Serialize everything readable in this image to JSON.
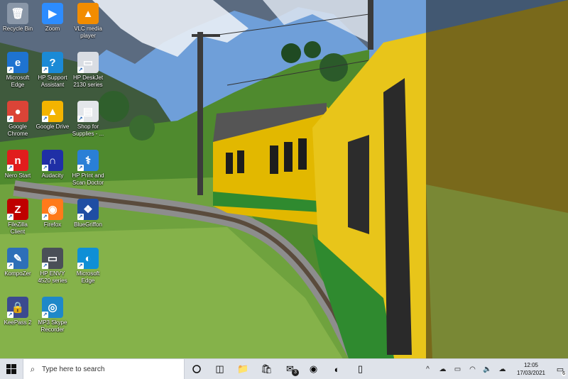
{
  "desktop_icons": [
    {
      "key": "recycle-bin",
      "label": "Recycle Bin",
      "icon": "recycle-bin-icon",
      "color": "#8a97a8",
      "glyph": "🗑"
    },
    {
      "key": "zoom",
      "label": "Zoom",
      "icon": "zoom-icon",
      "color": "#2d8cff",
      "glyph": "▶"
    },
    {
      "key": "vlc",
      "label": "VLC media player",
      "icon": "vlc-icon",
      "color": "#f28c00",
      "glyph": "▲"
    },
    {
      "key": "edge-legacy",
      "label": "Microsoft Edge",
      "icon": "edge-legacy-icon",
      "color": "#1e73d0",
      "glyph": "e"
    },
    {
      "key": "hp-support",
      "label": "HP Support Assistant",
      "icon": "hp-support-icon",
      "color": "#1b8ad6",
      "glyph": "?"
    },
    {
      "key": "hp-deskjet",
      "label": "HP DeskJet 2130 series",
      "icon": "printer-icon",
      "color": "#d9dde3",
      "glyph": "▭"
    },
    {
      "key": "chrome",
      "label": "Google Chrome",
      "icon": "chrome-icon",
      "color": "#db4437",
      "glyph": "●"
    },
    {
      "key": "google-drive",
      "label": "Google Drive",
      "icon": "google-drive-icon",
      "color": "#f4b400",
      "glyph": "▲"
    },
    {
      "key": "shop-supplies",
      "label": "Shop for Supplies - ...",
      "icon": "shop-supplies-icon",
      "color": "#e3e6ea",
      "glyph": "▤"
    },
    {
      "key": "nero",
      "label": "Nero Start",
      "icon": "nero-icon",
      "color": "#e11d1d",
      "glyph": "n"
    },
    {
      "key": "audacity",
      "label": "Audacity",
      "icon": "audacity-icon",
      "color": "#1f2fa6",
      "glyph": "∩"
    },
    {
      "key": "hp-print-scan",
      "label": "HP Print and Scan Doctor",
      "icon": "hp-print-scan-icon",
      "color": "#2a7fd6",
      "glyph": "⚕"
    },
    {
      "key": "filezilla",
      "label": "FileZilla Client",
      "icon": "filezilla-icon",
      "color": "#bf0000",
      "glyph": "Z"
    },
    {
      "key": "firefox",
      "label": "Firefox",
      "icon": "firefox-icon",
      "color": "#ff7a1a",
      "glyph": "◉"
    },
    {
      "key": "bluegriffon",
      "label": "BlueGriffon",
      "icon": "bluegriffon-icon",
      "color": "#1f4ea3",
      "glyph": "❖"
    },
    {
      "key": "kompozer",
      "label": "KompoZer",
      "icon": "kompozer-icon",
      "color": "#2d6fb8",
      "glyph": "✎"
    },
    {
      "key": "hp-envy",
      "label": "HP ENVY 4520 series",
      "icon": "printer-icon",
      "color": "#4a4f57",
      "glyph": "▭"
    },
    {
      "key": "edge",
      "label": "Microsoft Edge",
      "icon": "edge-icon",
      "color": "#0f8fd6",
      "glyph": "◐"
    },
    {
      "key": "keepass",
      "label": "KeePass 2",
      "icon": "keepass-icon",
      "color": "#3b4a8f",
      "glyph": "🔒"
    },
    {
      "key": "mp3-skype",
      "label": "MP3 Skype Recorder",
      "icon": "mp3-skype-recorder-icon",
      "color": "#1e88c9",
      "glyph": "◎"
    }
  ],
  "taskbar": {
    "search_placeholder": "Type here to search",
    "apps": [
      {
        "key": "task-view",
        "icon": "task-view-icon",
        "glyph": "◫",
        "running": false
      },
      {
        "key": "file-explorer",
        "icon": "file-explorer-icon",
        "glyph": "📁",
        "running": false
      },
      {
        "key": "store",
        "icon": "store-icon",
        "glyph": "🛍",
        "running": false
      },
      {
        "key": "mail",
        "icon": "mail-icon",
        "glyph": "✉",
        "running": false,
        "badge": "3"
      },
      {
        "key": "chrome",
        "icon": "chrome-icon",
        "glyph": "◉",
        "running": false
      },
      {
        "key": "edge",
        "icon": "edge-icon",
        "glyph": "◐",
        "running": false
      },
      {
        "key": "phone",
        "icon": "phone-icon",
        "glyph": "▯",
        "running": false
      }
    ],
    "tray": [
      {
        "key": "show-hidden",
        "icon": "chevron-up-icon",
        "glyph": "^"
      },
      {
        "key": "onedrive",
        "icon": "onedrive-icon",
        "glyph": "☁"
      },
      {
        "key": "battery",
        "icon": "battery-icon",
        "glyph": "▭"
      },
      {
        "key": "wifi",
        "icon": "wifi-icon",
        "glyph": "◠"
      },
      {
        "key": "volume",
        "icon": "volume-icon",
        "glyph": "🔈"
      },
      {
        "key": "cloud-upload",
        "icon": "cloud-upload-icon",
        "glyph": "☁"
      }
    ],
    "time": "12:05",
    "date": "17/03/2021",
    "notifications_count": "6"
  }
}
